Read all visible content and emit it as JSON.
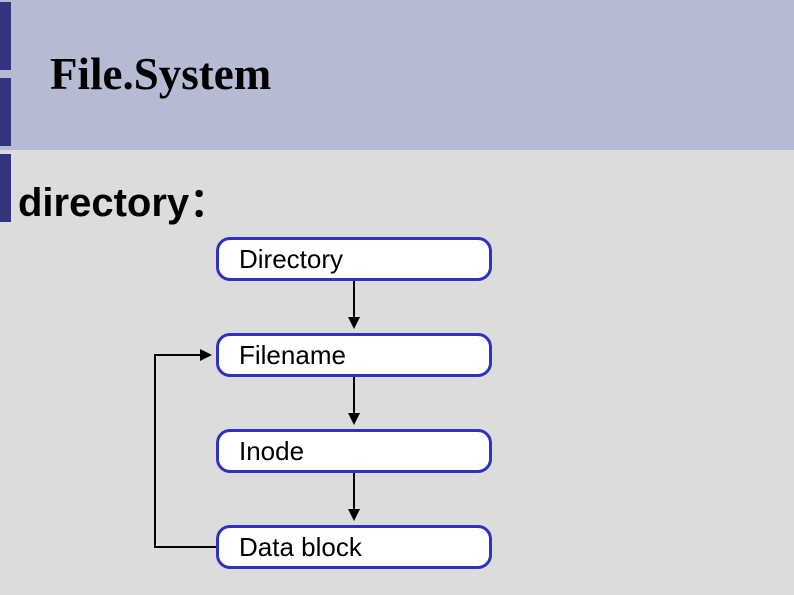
{
  "title": "File.System",
  "subtitle": "directory：",
  "nodes": {
    "directory": "Directory",
    "filename": "Filename",
    "inode": "Inode",
    "datablock": "Data block"
  }
}
